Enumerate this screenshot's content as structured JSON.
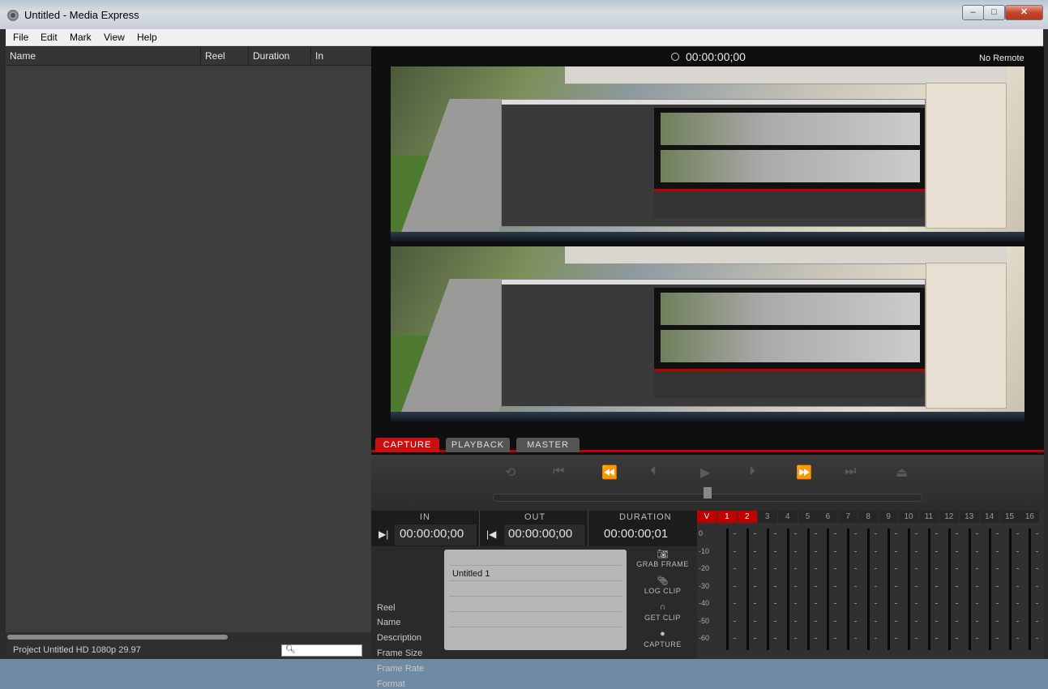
{
  "window": {
    "title": "Untitled - Media Express",
    "minimize": "–",
    "maximize": "□",
    "close": "✕"
  },
  "menu": [
    "File",
    "Edit",
    "Mark",
    "View",
    "Help"
  ],
  "bin": {
    "columns": [
      "Name",
      "Reel",
      "Duration",
      "In"
    ],
    "status": "Project Untitled  HD 1080p 29.97",
    "search_placeholder": ""
  },
  "viewer": {
    "timecode": "00:00:00;00",
    "remote": "No Remote"
  },
  "tabs": [
    {
      "label": "CAPTURE",
      "active": true
    },
    {
      "label": "PLAYBACK",
      "active": false
    },
    {
      "label": "MASTER",
      "active": false
    }
  ],
  "timecodes": {
    "in_label": "IN",
    "in_value": "00:00:00;00",
    "out_label": "OUT",
    "out_value": "00:00:00;00",
    "duration_label": "DURATION",
    "duration_value": "00:00:00;01"
  },
  "clip_info": {
    "fields": [
      "Reel",
      "Name",
      "Description",
      "Frame Size",
      "Frame Rate",
      "Format"
    ],
    "name_value": "Untitled 1"
  },
  "actions": [
    {
      "label": "GRAB FRAME",
      "icon": "camera-icon"
    },
    {
      "label": "LOG CLIP",
      "icon": "paperclip-icon"
    },
    {
      "label": "GET CLIP",
      "icon": "magnet-icon"
    },
    {
      "label": "CAPTURE",
      "icon": "record-icon"
    }
  ],
  "meters": {
    "channels": [
      "V",
      "1",
      "2",
      "3",
      "4",
      "5",
      "6",
      "7",
      "8",
      "9",
      "10",
      "11",
      "12",
      "13",
      "14",
      "15",
      "16"
    ],
    "active_channels": [
      "V",
      "1",
      "2"
    ],
    "db_scale": [
      "0",
      "-10",
      "-20",
      "-30",
      "-40",
      "-50",
      "-60"
    ]
  },
  "colors": {
    "accent": "#c81010",
    "panel": "#3d3d3d"
  }
}
